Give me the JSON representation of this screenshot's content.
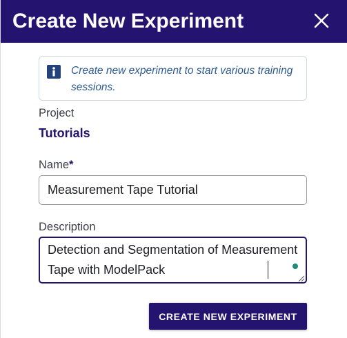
{
  "dialog": {
    "title": "Create New Experiment",
    "close_icon": "close-icon"
  },
  "info": {
    "icon": "info-icon",
    "text": "Create new experiment to start various training sessions."
  },
  "project": {
    "label": "Project",
    "value": "Tutorials"
  },
  "name_field": {
    "label": "Name",
    "required_mark": "*",
    "value": "Measurement Tape Tutorial"
  },
  "description_field": {
    "label": "Description",
    "value": "Detection and Segmentation of Measurement Tape with ModelPack"
  },
  "actions": {
    "create_label": "CREATE NEW EXPERIMENT"
  },
  "colors": {
    "header_bg": "#24136f",
    "accent": "#24136f",
    "info_text": "#2c5a92",
    "status_dot": "#1e8b7c"
  }
}
